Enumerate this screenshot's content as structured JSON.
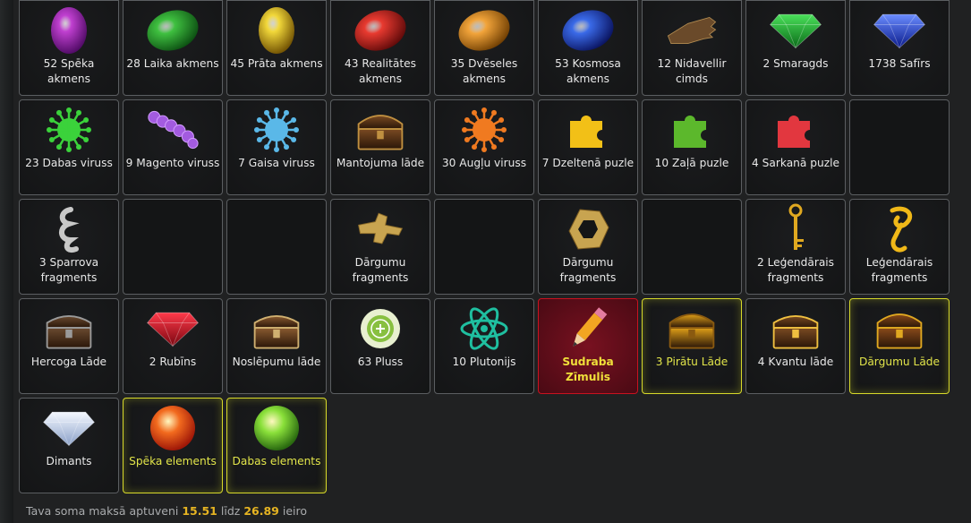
{
  "items": [
    {
      "label": "52 Spēka akmens",
      "icon": "purple-stone-icon",
      "style": "normal"
    },
    {
      "label": "28 Laika akmens",
      "icon": "green-stone-icon",
      "style": "normal"
    },
    {
      "label": "45 Prāta akmens",
      "icon": "yellow-stone-icon",
      "style": "normal"
    },
    {
      "label": "43 Realitātes akmens",
      "icon": "red-stone-icon",
      "style": "normal"
    },
    {
      "label": "35 Dvēseles akmens",
      "icon": "orange-stone-icon",
      "style": "normal"
    },
    {
      "label": "53 Kosmosa akmens",
      "icon": "blue-stone-icon",
      "style": "normal"
    },
    {
      "label": "12 Nidavellir cimds",
      "icon": "gauntlet-icon",
      "style": "normal"
    },
    {
      "label": "2 Smaragds",
      "icon": "emerald-icon",
      "style": "normal"
    },
    {
      "label": "1738 Safīrs",
      "icon": "sapphire-icon",
      "style": "normal"
    },
    {
      "label": "23 Dabas viruss",
      "icon": "green-virus-icon",
      "style": "normal"
    },
    {
      "label": "9 Magento viruss",
      "icon": "magenta-virus-icon",
      "style": "normal"
    },
    {
      "label": "7 Gaisa viruss",
      "icon": "blue-virus-icon",
      "style": "normal"
    },
    {
      "label": "Mantojuma lāde",
      "icon": "heritage-chest-icon",
      "style": "normal"
    },
    {
      "label": "30 Augļu viruss",
      "icon": "orange-virus-icon",
      "style": "normal"
    },
    {
      "label": "7 Dzeltenā puzle",
      "icon": "yellow-puzzle-icon",
      "style": "normal"
    },
    {
      "label": "10 Zaļā puzle",
      "icon": "green-puzzle-icon",
      "style": "normal"
    },
    {
      "label": "4 Sarkanā puzle",
      "icon": "red-puzzle-icon",
      "style": "normal"
    },
    {
      "label": "",
      "icon": "",
      "style": "empty"
    },
    {
      "label": "3 Sparrova fragments",
      "icon": "sparrow-fragment-icon",
      "style": "normal"
    },
    {
      "label": "",
      "icon": "",
      "style": "empty"
    },
    {
      "label": "",
      "icon": "",
      "style": "empty"
    },
    {
      "label": "Dārgumu fragments",
      "icon": "treasure-key-fragment-icon",
      "style": "normal"
    },
    {
      "label": "",
      "icon": "",
      "style": "empty"
    },
    {
      "label": "Dārgumu fragments",
      "icon": "treasure-ring-fragment-icon",
      "style": "normal"
    },
    {
      "label": "",
      "icon": "",
      "style": "empty"
    },
    {
      "label": "2 Leģendārais fragments",
      "icon": "legendary-key-icon",
      "style": "normal"
    },
    {
      "label": "Leģendārais fragments",
      "icon": "legendary-fragment-icon",
      "style": "normal"
    },
    {
      "label": "Hercoga Lāde",
      "icon": "duke-chest-icon",
      "style": "normal"
    },
    {
      "label": "2 Rubīns",
      "icon": "ruby-icon",
      "style": "normal"
    },
    {
      "label": "Noslēpumu lāde",
      "icon": "mystery-chest-icon",
      "style": "normal"
    },
    {
      "label": "63 Pluss",
      "icon": "plus-coin-icon",
      "style": "normal"
    },
    {
      "label": "10 Plutonijs",
      "icon": "atom-icon",
      "style": "normal"
    },
    {
      "label": "Sudraba Zīmulis",
      "icon": "pencil-icon",
      "style": "red"
    },
    {
      "label": "3 Pirātu Lāde",
      "icon": "pirate-chest-icon",
      "style": "yellow"
    },
    {
      "label": "4 Kvantu lāde",
      "icon": "quantum-chest-icon",
      "style": "normal"
    },
    {
      "label": "Dārgumu Lāde",
      "icon": "treasure-chest-icon",
      "style": "yellow"
    },
    {
      "label": "Dimants",
      "icon": "diamond-icon",
      "style": "normal"
    },
    {
      "label": "Spēka elements",
      "icon": "power-element-icon",
      "style": "yellow"
    },
    {
      "label": "Dabas elements",
      "icon": "nature-element-icon",
      "style": "yellow"
    }
  ],
  "footer": {
    "prefix": "Tava soma maksā aptuveni",
    "min": "15.51",
    "mid": "līdz",
    "max": "26.89",
    "suffix": "ieiro"
  },
  "colors": {
    "highlight_yellow": "#d7d92a",
    "highlight_red": "#c8121f",
    "footer_number": "#e6b422"
  }
}
